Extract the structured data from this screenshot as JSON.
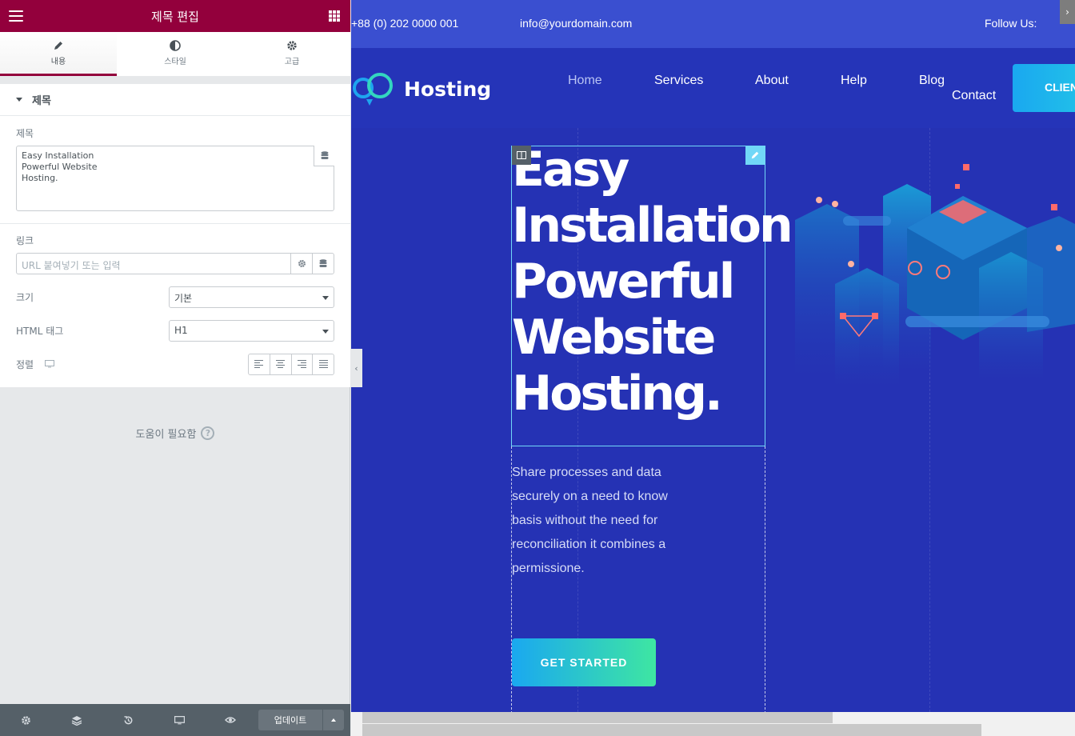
{
  "panel": {
    "title": "제목 편집",
    "tabs": [
      {
        "label": "내용",
        "icon": "pencil-icon"
      },
      {
        "label": "스타일",
        "icon": "contrast-icon"
      },
      {
        "label": "고급",
        "icon": "gear-icon"
      }
    ],
    "section_title": "제목",
    "title_field": {
      "label": "제목",
      "value": "Easy Installation\nPowerful Website\nHosting."
    },
    "link_field": {
      "label": "링크",
      "placeholder": "URL 붙여넣기 또는 입력"
    },
    "size_field": {
      "label": "크기",
      "value": "기본"
    },
    "html_tag_field": {
      "label": "HTML 태그",
      "value": "H1"
    },
    "alignment_field": {
      "label": "정렬"
    },
    "help_text": "도움이 필요함",
    "footer": {
      "update_label": "업데이트"
    }
  },
  "preview": {
    "topbar": {
      "phone": "+88 (0) 202 0000 001",
      "email": "info@yourdomain.com",
      "follow": "Follow Us:"
    },
    "logo_text": "Hosting",
    "nav": [
      "Home",
      "Services",
      "About",
      "Help",
      "Blog",
      "Contact"
    ],
    "client_button": "CLIEN",
    "hero_heading": "Easy\nInstallation\nPowerful\nWebsite\nHosting.",
    "hero_description": "Share processes and data securely on a need to know basis without the need for reconciliation it combines a permissione.",
    "cta_label": "GET STARTED"
  },
  "colors": {
    "panel_accent": "#93003c",
    "preview_bg": "#2532b4",
    "topbar_bg": "#3a4fd0",
    "cta_gradient_start": "#1aa8f0",
    "cta_gradient_end": "#3ee6a2"
  }
}
